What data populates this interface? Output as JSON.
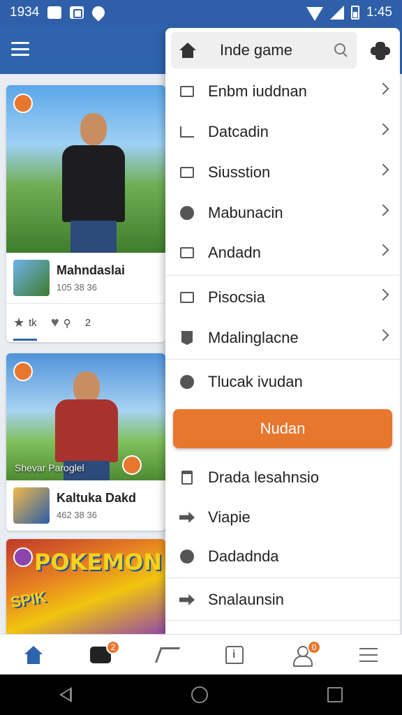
{
  "status_bar": {
    "time_left": "1934",
    "time_right": "1:45"
  },
  "feed": {
    "card1": {
      "title": "Mahndaslai",
      "meta": "105 38 36",
      "action_star": "tk",
      "action_count": "2"
    },
    "card2": {
      "caption": "Shevar Paroglel",
      "title": "Kaltuka Dakd",
      "meta": "462 38 36"
    },
    "card3": {
      "poster_title": "POKEMON",
      "poster_sub": "SPIK"
    }
  },
  "menu": {
    "search": {
      "label": "Inde game"
    },
    "items": [
      {
        "label": "Enbm iuddnan",
        "icon": "mail-icon"
      },
      {
        "label": "Datcadin",
        "icon": "chart-icon"
      },
      {
        "label": "Siusstion",
        "icon": "tag-icon"
      },
      {
        "label": "Mabunacin",
        "icon": "palette-icon"
      },
      {
        "label": "Andadn",
        "icon": "box-icon"
      },
      {
        "label": "Pisocsia",
        "icon": "folder-icon"
      },
      {
        "label": "Mdalinglacne",
        "icon": "bookmark-icon"
      },
      {
        "label": "Tlucak ivudan",
        "icon": "chat-icon"
      },
      {
        "label": "Drada lesahnsio",
        "icon": "trash-icon"
      },
      {
        "label": "Viapie",
        "icon": "send-icon"
      },
      {
        "label": "Dadadnda",
        "icon": "clock-icon"
      },
      {
        "label": "Snalaunsin",
        "icon": "diamond-icon"
      }
    ],
    "primary_button": "Nudan"
  },
  "bottom_nav": {
    "game_badge": "2",
    "profile_badge": "0"
  },
  "colors": {
    "primary": "#2e63ad",
    "accent": "#e8772e"
  }
}
